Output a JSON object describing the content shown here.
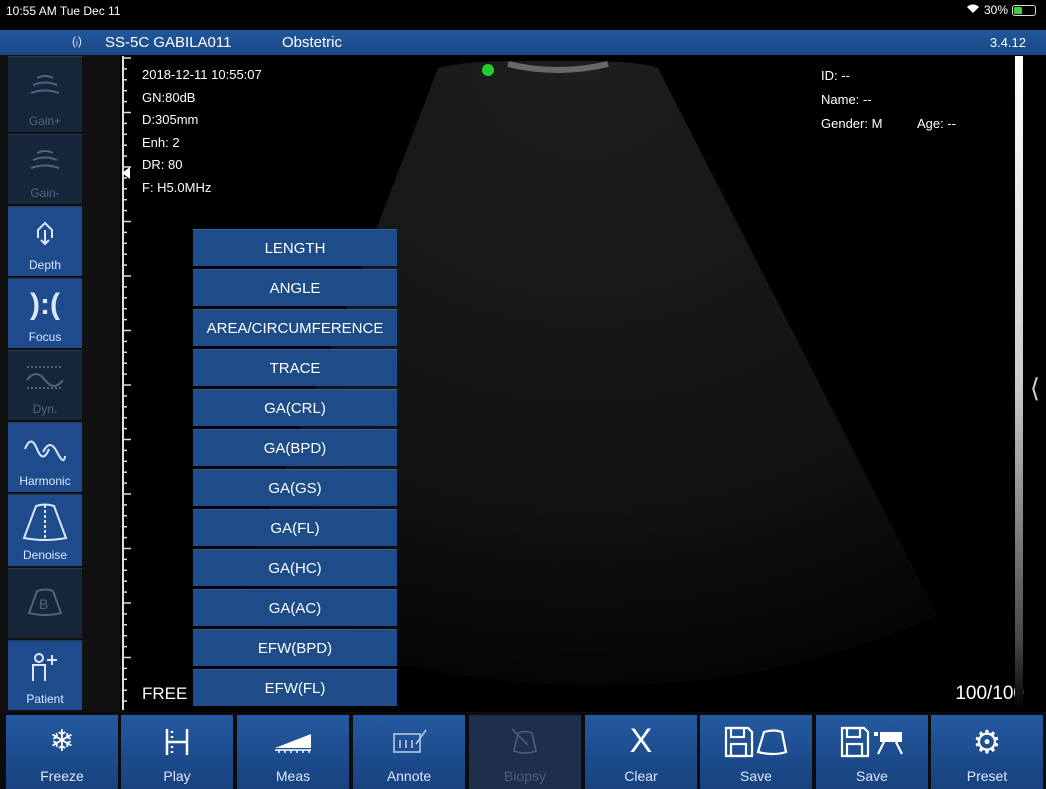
{
  "status_bar": {
    "time": "10:55 AM  Tue Dec 11",
    "battery": "30%"
  },
  "header": {
    "device": "SS-5C GABILA011",
    "mode": "Obstetric",
    "version": "3.4.12"
  },
  "left_toolbar": [
    {
      "label": "Gain+",
      "icon": "gain-plus-icon"
    },
    {
      "label": "Gain-",
      "icon": "gain-minus-icon"
    },
    {
      "label": "Depth",
      "icon": "depth-icon"
    },
    {
      "label": "Focus",
      "icon": "focus-icon"
    },
    {
      "label": "Dyn.",
      "icon": "dynamic-range-icon"
    },
    {
      "label": "Harmonic",
      "icon": "harmonic-icon"
    },
    {
      "label": "Denoise",
      "icon": "denoise-icon"
    },
    {
      "label": "B",
      "icon": "b-mode-icon"
    },
    {
      "label": "Patient",
      "icon": "patient-icon"
    }
  ],
  "scan_info": {
    "datetime": "2018-12-11 10:55:07",
    "gain": "GN:80dB",
    "depth": "D:305mm",
    "enhance": "Enh: 2",
    "dynamic_range": "DR: 80",
    "frequency": "F: H5.0MHz"
  },
  "patient": {
    "id": "ID: --",
    "name": "Name: --",
    "gender": "Gender: M",
    "age": "Age: --"
  },
  "measure_menu": [
    "LENGTH",
    "ANGLE",
    "AREA/CIRCUMFERENCE",
    "TRACE",
    "GA(CRL)",
    "GA(BPD)",
    "GA(GS)",
    "GA(FL)",
    "GA(HC)",
    "GA(AC)",
    "EFW(BPD)",
    "EFW(FL)"
  ],
  "free_label": "FREE",
  "frame_count": "100/100",
  "bottom_toolbar": [
    {
      "label": "Freeze",
      "icon": "snowflake-icon"
    },
    {
      "label": "Play",
      "icon": "play-cine-icon"
    },
    {
      "label": "Meas",
      "icon": "ruler-measure-icon"
    },
    {
      "label": "Annote",
      "icon": "annotate-icon"
    },
    {
      "label": "Biopsy",
      "icon": "biopsy-icon",
      "disabled": true
    },
    {
      "label": "Clear",
      "icon": "clear-x-icon"
    },
    {
      "label": "Save",
      "icon": "save-image-icon"
    },
    {
      "label": "Save",
      "icon": "save-cine-icon"
    },
    {
      "label": "Preset",
      "icon": "gear-icon"
    }
  ]
}
